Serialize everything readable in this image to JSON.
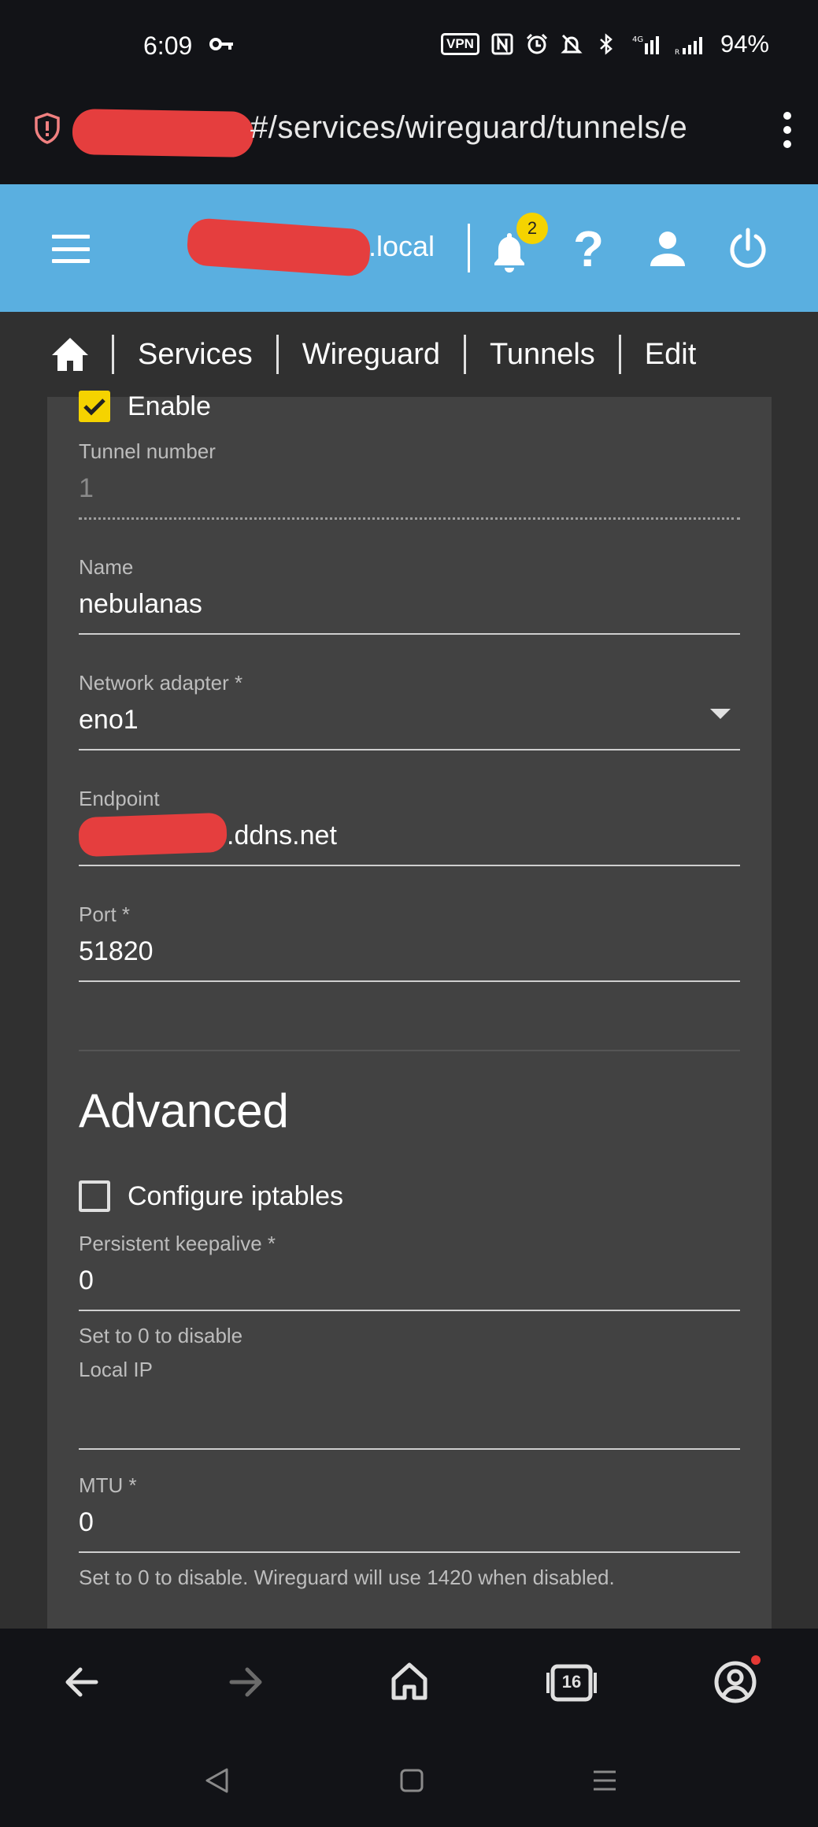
{
  "status_bar": {
    "time": "6:09",
    "vpn": "VPN",
    "battery": "94%"
  },
  "browser": {
    "url_visible": "#/services/wireguard/tunnels/e",
    "tab_count": "16"
  },
  "toolbar": {
    "hostname_suffix": ".local",
    "notification_count": "2",
    "help_glyph": "?"
  },
  "breadcrumb": {
    "items": [
      "Services",
      "Wireguard",
      "Tunnels",
      "Edit"
    ]
  },
  "form": {
    "enable": {
      "label": "Enable",
      "checked": true
    },
    "tunnel_number": {
      "label": "Tunnel number",
      "value": "1"
    },
    "name": {
      "label": "Name",
      "value": "nebulanas"
    },
    "network_adapter": {
      "label": "Network adapter *",
      "value": "eno1"
    },
    "endpoint": {
      "label": "Endpoint",
      "value": ".ddns.net"
    },
    "port": {
      "label": "Port *",
      "value": "51820"
    }
  },
  "advanced": {
    "title": "Advanced",
    "configure_iptables": {
      "label": "Configure iptables",
      "checked": false
    },
    "persistent_keepalive": {
      "label": "Persistent keepalive *",
      "value": "0",
      "hint": "Set to 0 to disable"
    },
    "local_ip": {
      "label": "Local IP",
      "value": ""
    },
    "mtu": {
      "label": "MTU *",
      "value": "0",
      "hint": "Set to 0 to disable. Wireguard will use 1420 when disabled."
    }
  },
  "colors": {
    "toolbar": "#5aafe0",
    "checkbox_accent": "#f5d300",
    "badge": "#f5d300",
    "redaction": "#e53e3e"
  },
  "icons": [
    "key-icon",
    "nfc-icon",
    "alarm-icon",
    "mute-icon",
    "bluetooth-icon",
    "signal-icon",
    "shield-icon",
    "menu-icon",
    "bell-icon",
    "help-icon",
    "user-icon",
    "power-icon",
    "home-icon",
    "back-icon",
    "forward-icon",
    "tabs-icon",
    "account-icon"
  ]
}
